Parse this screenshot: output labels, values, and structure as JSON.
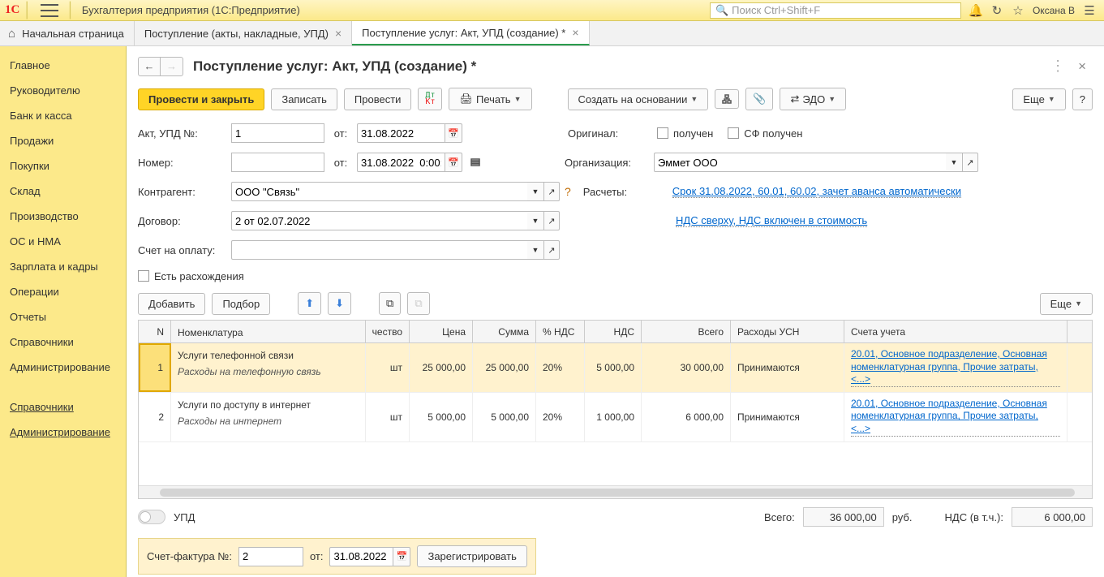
{
  "app": {
    "title": "Бухгалтерия предприятия  (1С:Предприятие)",
    "search_placeholder": "Поиск Ctrl+Shift+F",
    "user": "Оксана В"
  },
  "tabs": [
    {
      "label": "Начальная страница"
    },
    {
      "label": "Поступление (акты, накладные, УПД)"
    },
    {
      "label": "Поступление услуг: Акт, УПД (создание) *",
      "active": true
    }
  ],
  "sidebar": {
    "items": [
      "Главное",
      "Руководителю",
      "Банк и касса",
      "Продажи",
      "Покупки",
      "Склад",
      "Производство",
      "ОС и НМА",
      "Зарплата и кадры",
      "Операции",
      "Отчеты",
      "Справочники",
      "Администрирование"
    ],
    "sub": [
      "Справочники",
      "Администрирование"
    ]
  },
  "page": {
    "title": "Поступление услуг: Акт, УПД (создание) *"
  },
  "toolbar": {
    "post_close": "Провести и закрыть",
    "write": "Записать",
    "post": "Провести",
    "print": "Печать",
    "create_based": "Создать на основании",
    "edo": "ЭДО",
    "more": "Еще",
    "help": "?"
  },
  "form": {
    "akt_no_label": "Акт, УПД №:",
    "akt_no": "1",
    "ot": "от:",
    "akt_date": "31.08.2022",
    "num_label": "Номер:",
    "num": "",
    "num_date": "31.08.2022  0:00:00",
    "original_label": "Оригинал:",
    "received": "получен",
    "sf_received": "СФ получен",
    "org_label": "Организация:",
    "org": "Эммет ООО",
    "ctr_label": "Контрагент:",
    "ctr": "ООО \"Связь\"",
    "calc_label": "Расчеты:",
    "calc_link": "Срок 31.08.2022, 60.01, 60.02, зачет аванса автоматически",
    "dog_label": "Договор:",
    "dog": "2 от 02.07.2022",
    "nds_link": "НДС сверху, НДС включен в стоимость",
    "invoice_label": "Счет на оплату:",
    "invoice": "",
    "disc_label": "Есть расхождения"
  },
  "table_toolbar": {
    "add": "Добавить",
    "pick": "Подбор",
    "more": "Еще"
  },
  "table": {
    "headers": {
      "n": "N",
      "nom": "Номенклатура",
      "qty": "чество",
      "price": "Цена",
      "sum": "Сумма",
      "vat_rate": "% НДС",
      "vat": "НДС",
      "total": "Всего",
      "usn": "Расходы УСН",
      "acc": "Счета учета"
    },
    "rows": [
      {
        "n": "1",
        "nom": "Услуги телефонной связи",
        "nom_sub": "Расходы на телефонную связь",
        "unit": "шт",
        "price": "25 000,00",
        "sum": "25 000,00",
        "vat_rate": "20%",
        "vat": "5 000,00",
        "total": "30 000,00",
        "usn": "Принимаются",
        "acc": "20.01, Основное подразделение, Основная номенклатурная группа, Прочие затраты, <...>"
      },
      {
        "n": "2",
        "nom": "Услуги по доступу в интернет",
        "nom_sub": "Расходы на интернет",
        "unit": "шт",
        "price": "5 000,00",
        "sum": "5 000,00",
        "vat_rate": "20%",
        "vat": "1 000,00",
        "total": "6 000,00",
        "usn": "Принимаются",
        "acc": "20.01, Основное подразделение, Основная номенклатурная группа, Прочие затраты, <...>"
      }
    ]
  },
  "totals": {
    "upd": "УПД",
    "total_label": "Всего:",
    "total": "36 000,00",
    "currency": "руб.",
    "vat_label": "НДС (в т.ч.):",
    "vat": "6 000,00"
  },
  "sf": {
    "label": "Счет-фактура №:",
    "num": "2",
    "ot": "от:",
    "date": "31.08.2022",
    "reg": "Зарегистрировать"
  }
}
